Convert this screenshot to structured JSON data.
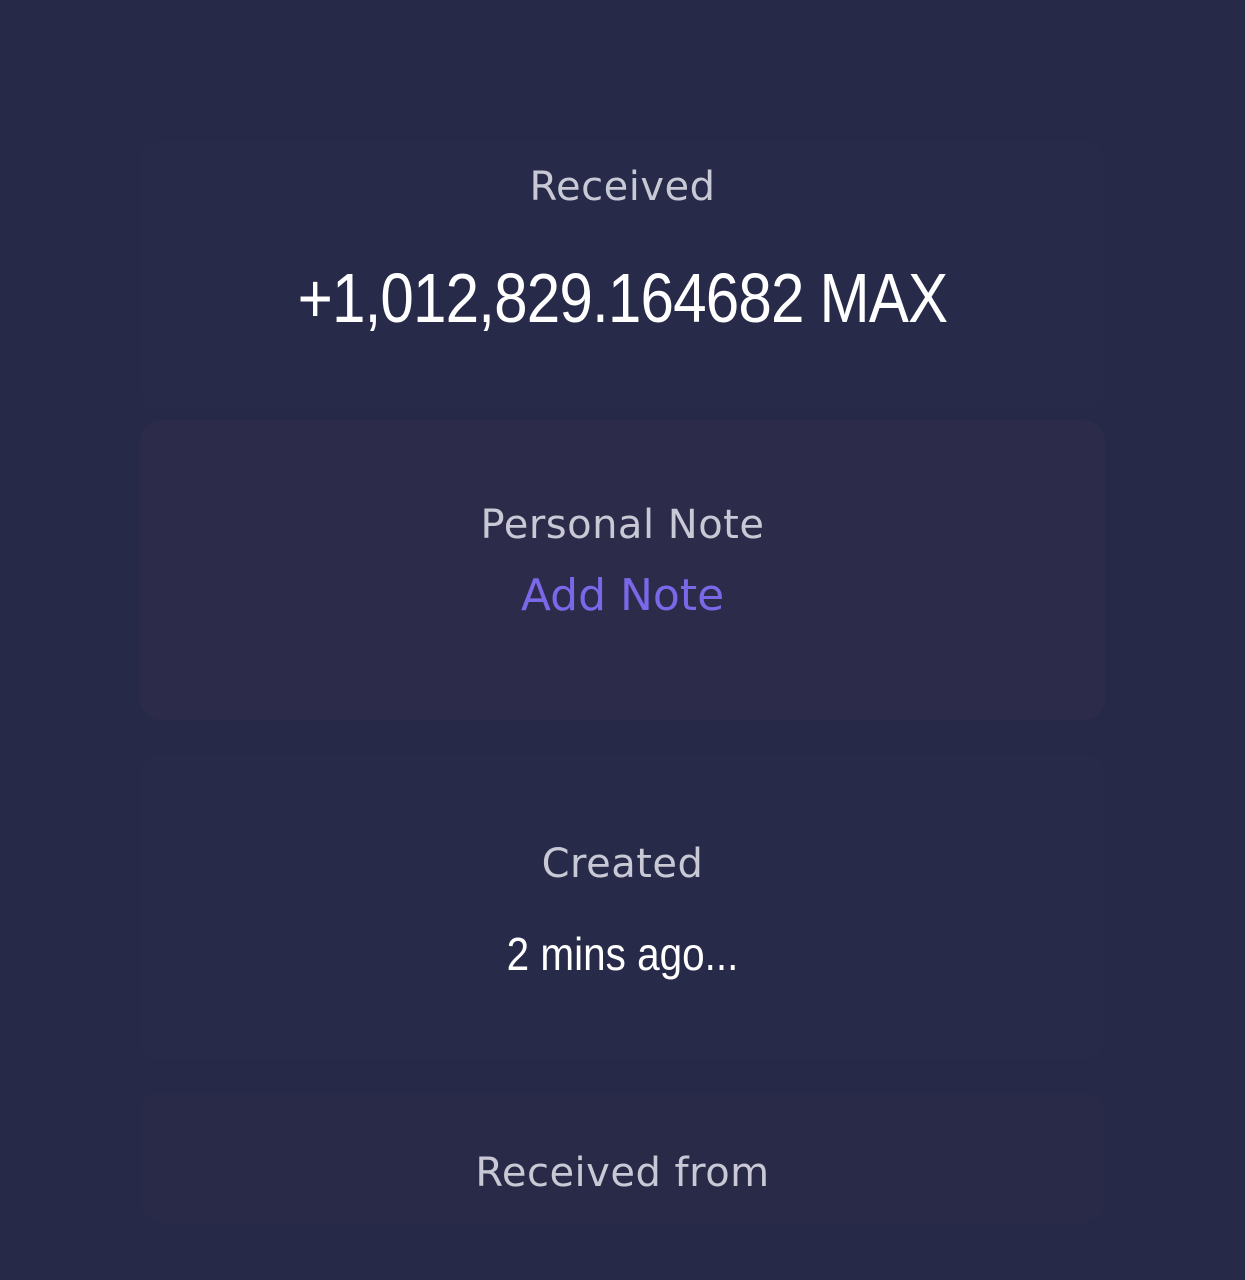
{
  "transaction": {
    "status_label": "Received",
    "amount": "+1,012,829.164682 MAX"
  },
  "note": {
    "label": "Personal Note",
    "action": "Add Note"
  },
  "created": {
    "label": "Created",
    "value": "2 mins ago..."
  },
  "sender": {
    "label": "Received from"
  },
  "colors": {
    "background": "#262a48",
    "accent": "#7b68e8",
    "text_primary": "#ffffff",
    "text_secondary": "#c9c9d6"
  }
}
